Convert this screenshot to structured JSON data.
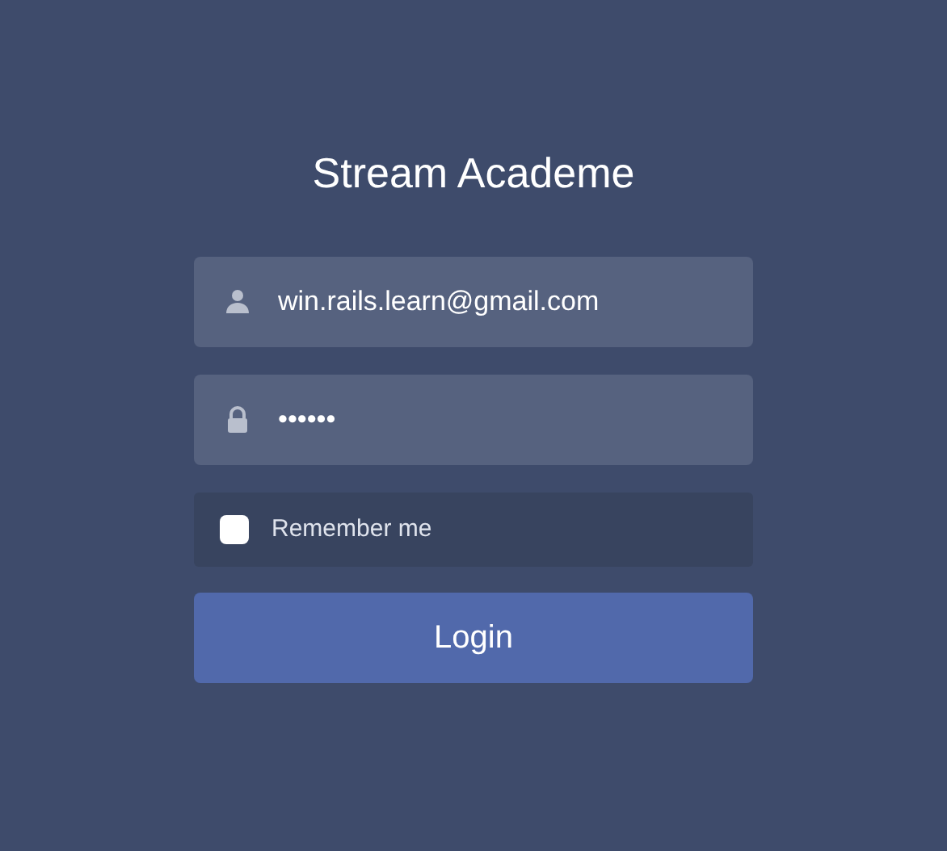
{
  "title": "Stream Academe",
  "fields": [
    {
      "kind": "user",
      "value": "win.rails.learn@gmail.com"
    },
    {
      "kind": "lock",
      "value": "••••••"
    }
  ],
  "remember": {
    "label": "Remember me",
    "checked": false
  },
  "button": "Login"
}
